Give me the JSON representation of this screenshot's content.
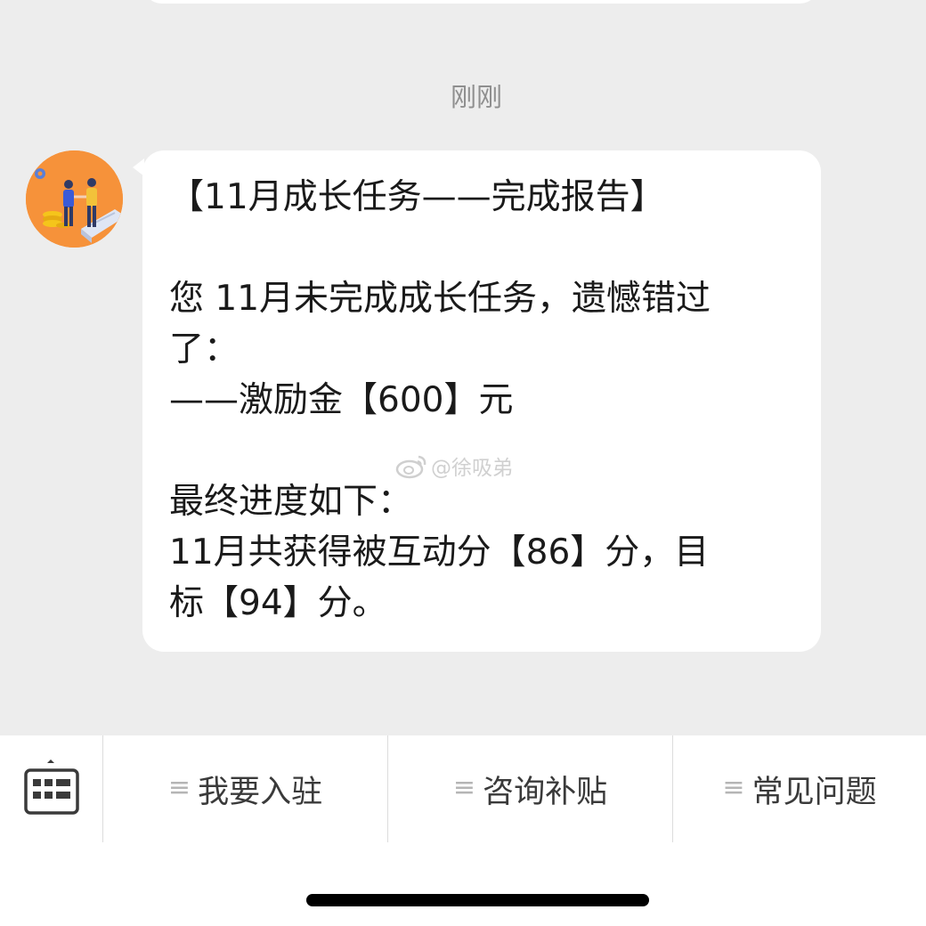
{
  "chat": {
    "timestamp": "刚刚",
    "message": {
      "lines": [
        "【11月成长任务——完成报告】",
        "",
        "您 11月未完成成长任务，遗憾错过",
        "了：",
        "——激励金【600】元",
        "",
        "最终进度如下：",
        "11月共获得被互动分【86】分，目",
        "标【94】分。"
      ]
    },
    "watermark": "@徐吸弟"
  },
  "menu": {
    "keyboard_icon": "keyboard-icon",
    "items": [
      {
        "label": "我要入驻",
        "icon": "menu-lines-icon"
      },
      {
        "label": "咨询补贴",
        "icon": "menu-lines-icon"
      },
      {
        "label": "常见问题",
        "icon": "menu-lines-icon"
      }
    ]
  },
  "colors": {
    "background": "#ededed",
    "bubble": "#ffffff",
    "avatar_bg": "#f6923a",
    "text": "#1a1a1a",
    "muted": "#8f8f8f"
  }
}
